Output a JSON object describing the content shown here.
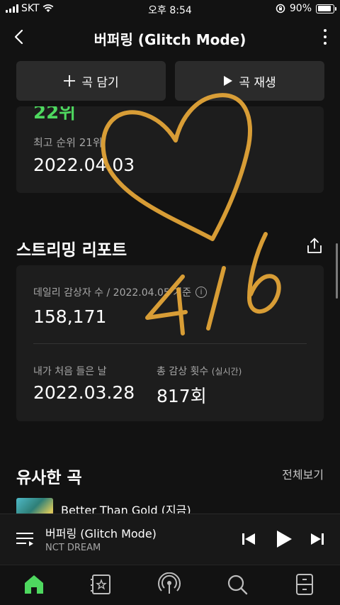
{
  "status_bar": {
    "carrier": "SKT",
    "time": "오후 8:54",
    "battery_text": "90%",
    "battery_level": 0.9
  },
  "header": {
    "title": "버퍼링 (Glitch Mode)",
    "back_icon": "chevron-left-icon",
    "more_icon": "more-vertical-icon"
  },
  "actions": {
    "add_label": "곡 담기",
    "play_label": "곡 재생"
  },
  "chart": {
    "rank_text": "22위",
    "best_rank_label": "최고 순위 21위",
    "best_rank_date": "2022.04.03"
  },
  "streaming_report": {
    "title": "스트리밍 리포트",
    "daily_listeners_label": "데일리 감상자 수 / 2022.04.05 기준",
    "daily_listeners_value": "158,171",
    "first_listen_label": "내가 처음 들은 날",
    "first_listen_value": "2022.03.28",
    "total_plays_label": "총 감상 횟수",
    "total_plays_sub": "(실시간)",
    "total_plays_value": "817회"
  },
  "similar": {
    "title": "유사한 곡",
    "see_all": "전체보기",
    "first_song": "Better Than Gold (지금)"
  },
  "player": {
    "title": "버퍼링 (Glitch Mode)",
    "artist": "NCT DREAM"
  },
  "tabs": [
    "home-icon",
    "library-icon",
    "podcast-icon",
    "search-icon",
    "storage-icon"
  ],
  "handwriting": {
    "text": "4/6",
    "color": "#e8a838"
  },
  "colors": {
    "accent_green": "#4ed85f",
    "background": "#121212",
    "card": "#1d1d1d"
  }
}
